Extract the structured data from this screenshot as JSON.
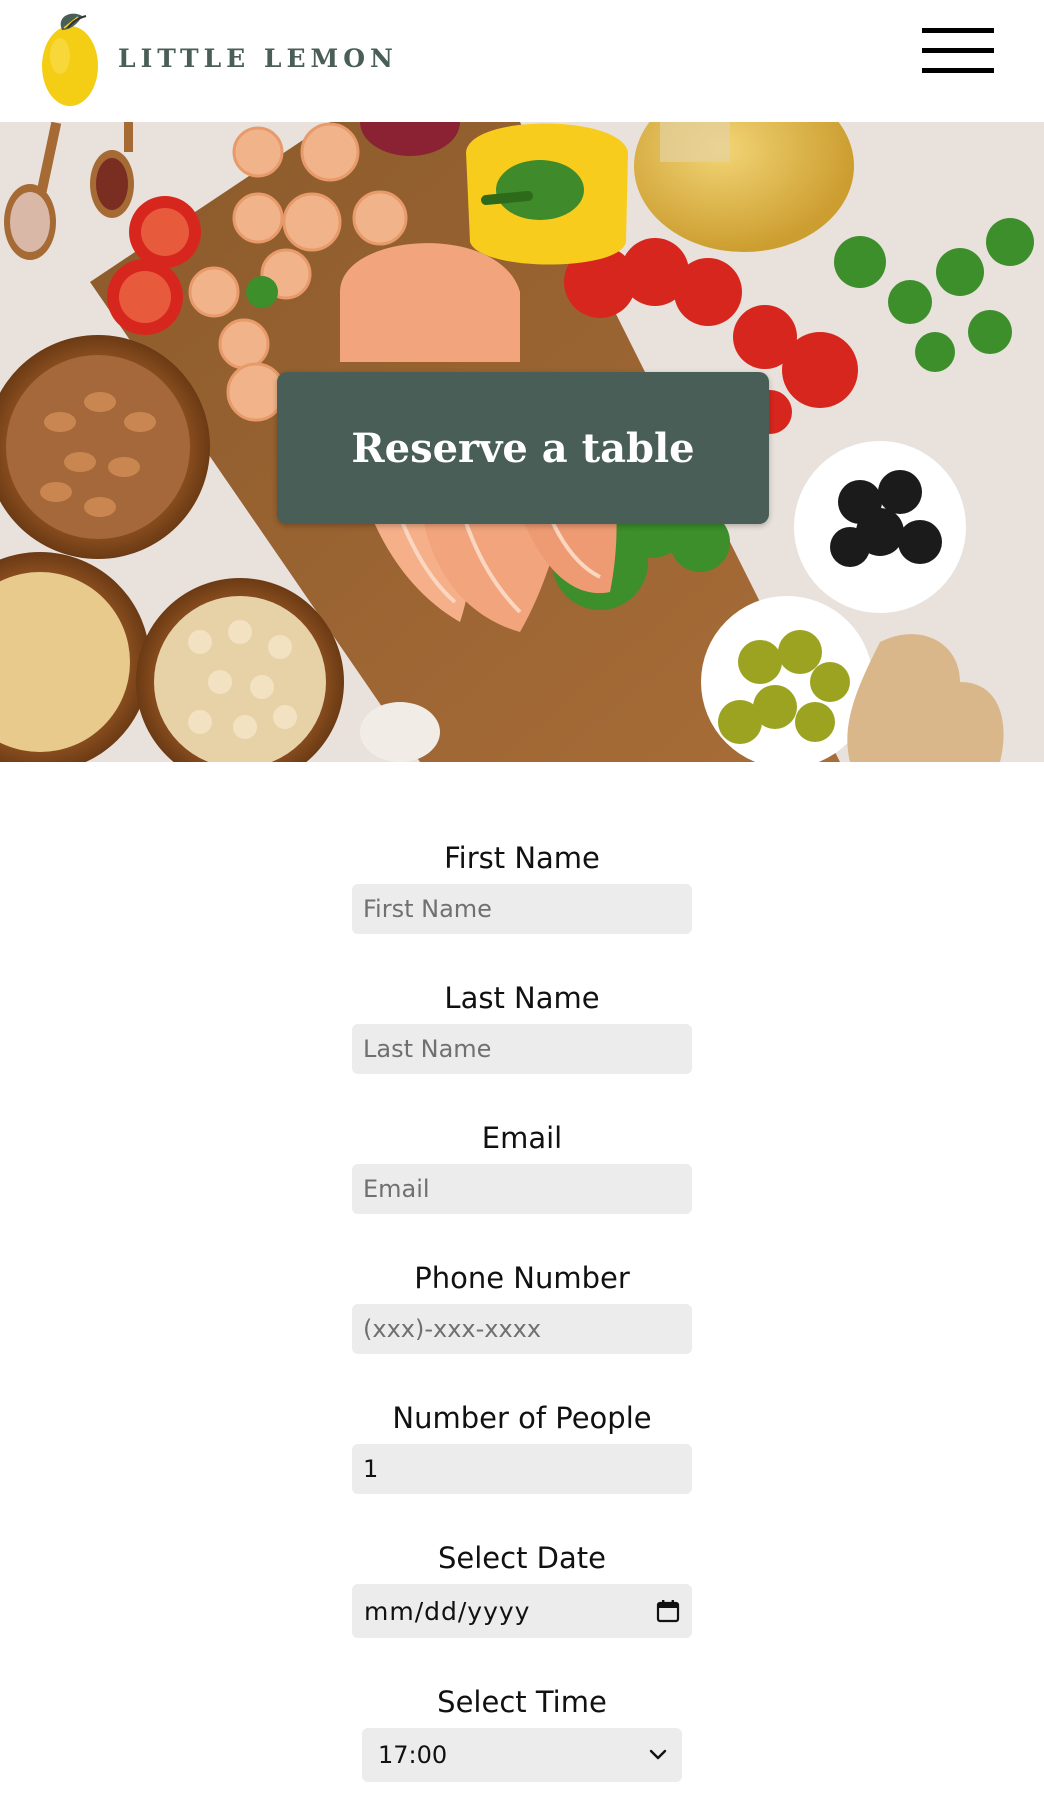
{
  "header": {
    "logo_text": "LITTLE LEMON",
    "menu_icon": "hamburger-menu-icon"
  },
  "hero": {
    "cta_label": "Reserve a table"
  },
  "form": {
    "first_name": {
      "label": "First Name",
      "placeholder": "First Name",
      "value": ""
    },
    "last_name": {
      "label": "Last Name",
      "placeholder": "Last Name",
      "value": ""
    },
    "email": {
      "label": "Email",
      "placeholder": "Email",
      "value": ""
    },
    "phone": {
      "label": "Phone Number",
      "placeholder": "(xxx)-xxx-xxxx",
      "value": ""
    },
    "people": {
      "label": "Number of People",
      "value": "1"
    },
    "date": {
      "label": "Select Date",
      "value": "mm/dd/yyyy",
      "icon": "calendar-icon"
    },
    "time": {
      "label": "Select Time",
      "value": "17:00",
      "icon": "chevron-down-icon"
    }
  },
  "colors": {
    "brand_green": "#495e57",
    "lemon_yellow": "#f4ce14",
    "input_bg": "#ececec"
  }
}
